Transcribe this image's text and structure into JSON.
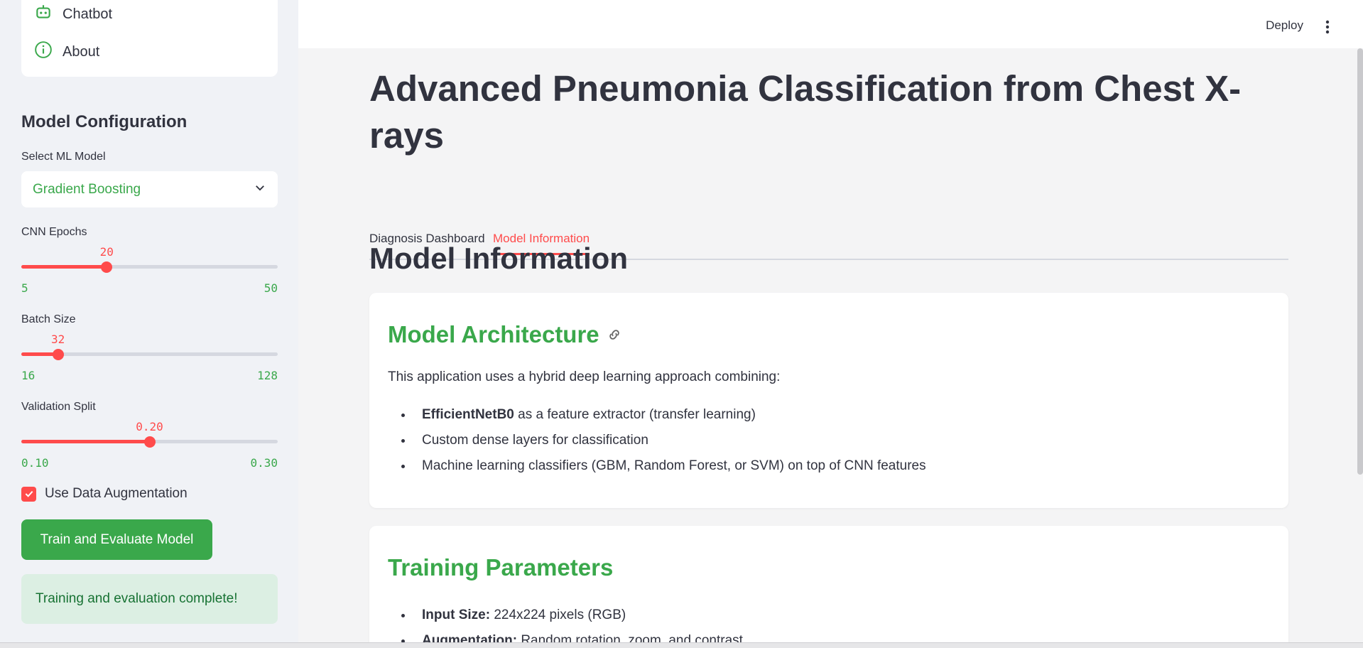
{
  "sidebar": {
    "nav": [
      {
        "label": "Chatbot",
        "icon": "robot-icon"
      },
      {
        "label": "About",
        "icon": "info-icon"
      }
    ],
    "section_title": "Model Configuration",
    "model_select": {
      "label": "Select ML Model",
      "value": "Gradient Boosting"
    },
    "sliders": [
      {
        "label": "CNN Epochs",
        "value": "20",
        "min": "5",
        "max": "50",
        "fraction": 0.333
      },
      {
        "label": "Batch Size",
        "value": "32",
        "min": "16",
        "max": "128",
        "fraction": 0.143
      },
      {
        "label": "Validation Split",
        "value": "0.20",
        "min": "0.10",
        "max": "0.30",
        "fraction": 0.5
      }
    ],
    "checkbox": {
      "label": "Use Data Augmentation",
      "checked": true
    },
    "train_button": "Train and Evaluate Model",
    "status": "Training and evaluation complete!"
  },
  "header": {
    "deploy": "Deploy"
  },
  "main": {
    "title": "Advanced Pneumonia Classification from Chest X-rays",
    "tabs": [
      {
        "label": "Diagnosis Dashboard",
        "active": false
      },
      {
        "label": "Model Information",
        "active": true
      }
    ],
    "section_heading": "Model Information",
    "architecture": {
      "heading": "Model Architecture",
      "intro": "This application uses a hybrid deep learning approach combining:",
      "items": [
        {
          "bold": "EfficientNetB0",
          "text": " as a feature extractor (transfer learning)"
        },
        {
          "bold": "",
          "text": "Custom dense layers for classification"
        },
        {
          "bold": "",
          "text": "Machine learning classifiers (GBM, Random Forest, or SVM) on top of CNN features"
        }
      ]
    },
    "training": {
      "heading": "Training Parameters",
      "items": [
        {
          "bold": "Input Size:",
          "text": " 224x224 pixels (RGB)"
        },
        {
          "bold": "Augmentation:",
          "text": " Random rotation, zoom, and contrast"
        }
      ]
    }
  },
  "colors": {
    "accent": "#ff4b4b",
    "green": "#3aa84b"
  }
}
